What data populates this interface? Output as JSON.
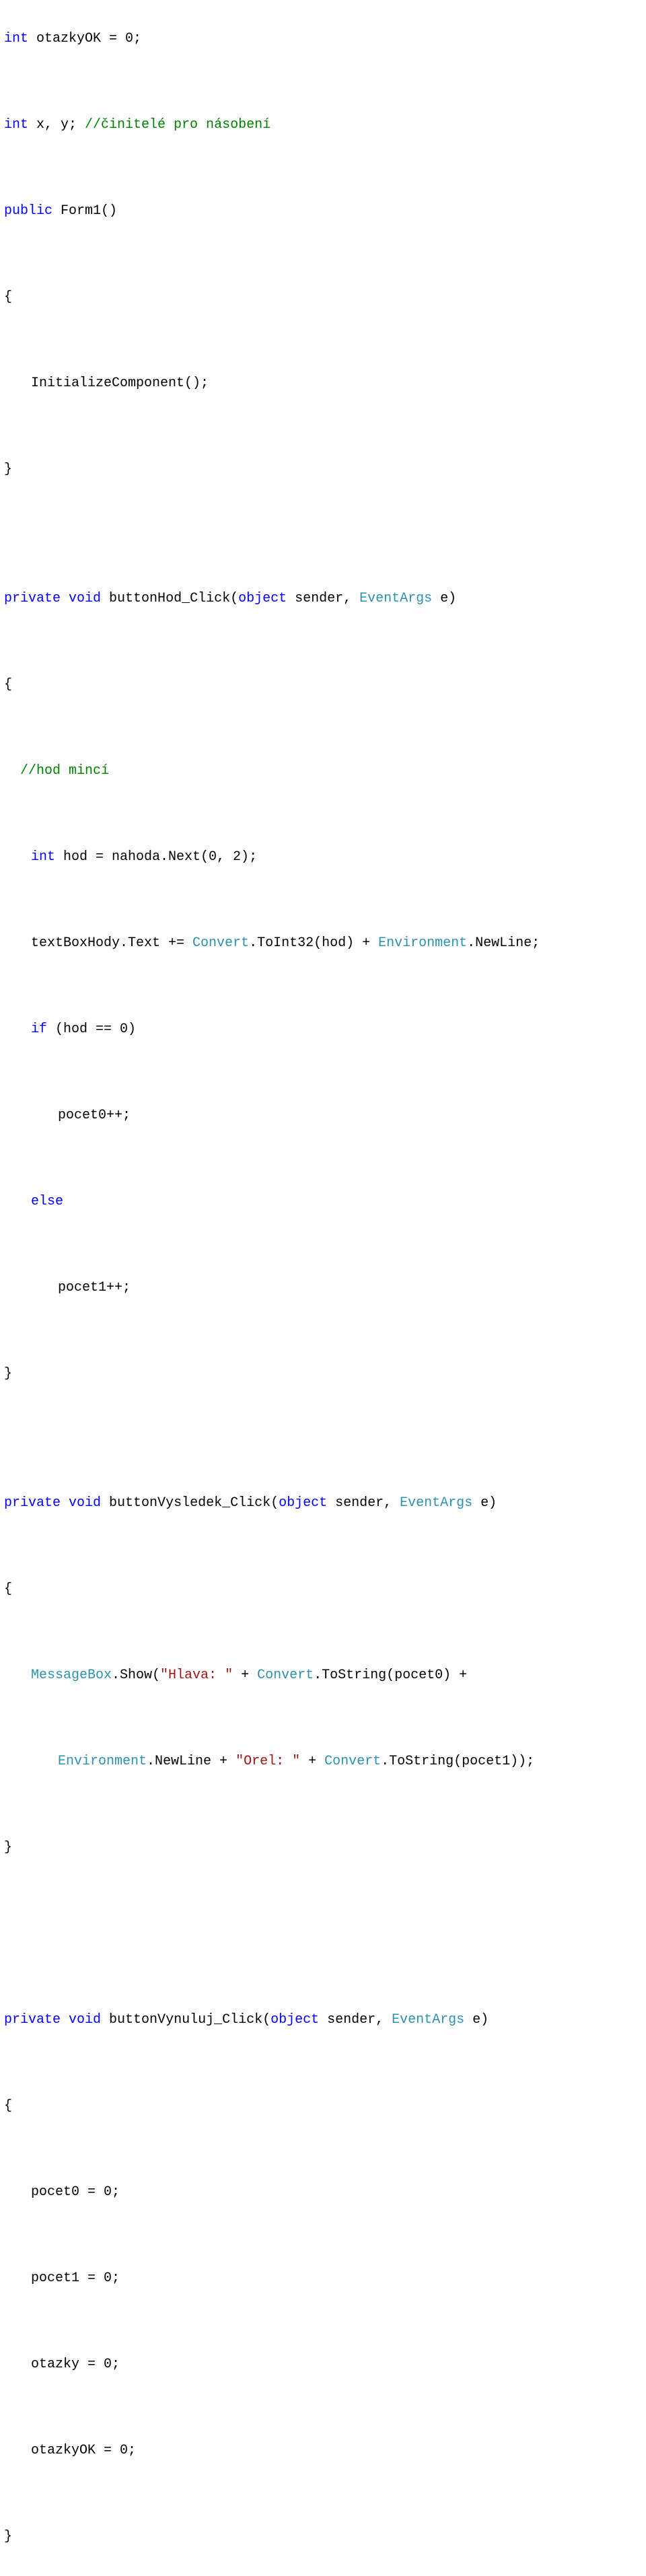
{
  "code": {
    "l01_kw_int": "int",
    "l01_rest": " otazkyOK = 0;",
    "l02_kw_int": "int",
    "l02_mid": " x, y; ",
    "l02_comment": "//činitelé pro násobení",
    "l03_kw_public": "public",
    "l03_rest": " Form1()",
    "l04": "{",
    "l05": "InitializeComponent();",
    "l06": "}",
    "l07_kw_private": "private",
    "l07_sp1": " ",
    "l07_kw_void": "void",
    "l07_mid": " buttonHod_Click(",
    "l07_kw_object": "object",
    "l07_mid2": " sender, ",
    "l07_cls": "EventArgs",
    "l07_end": " e)",
    "l08": "{",
    "l09_comment": "//hod mincí",
    "l10_kw_int": "int",
    "l10_rest": " hod = nahoda.Next(0, 2);",
    "l11_a": "textBoxHody.Text += ",
    "l11_cls1": "Convert",
    "l11_b": ".ToInt32(hod) + ",
    "l11_cls2": "Environment",
    "l11_c": ".NewLine;",
    "l12_kw_if": "if",
    "l12_rest": " (hod == 0)",
    "l13": "pocet0++;",
    "l14_kw_else": "else",
    "l15": "pocet1++;",
    "l16": "}",
    "l17_kw_private": "private",
    "l17_sp1": " ",
    "l17_kw_void": "void",
    "l17_mid": " buttonVysledek_Click(",
    "l17_kw_object": "object",
    "l17_mid2": " sender, ",
    "l17_cls": "EventArgs",
    "l17_end": " e)",
    "l18": "{",
    "l19_cls1": "MessageBox",
    "l19_a": ".Show(",
    "l19_str1": "\"Hlava: \"",
    "l19_b": " + ",
    "l19_cls2": "Convert",
    "l19_c": ".ToString(pocet0) +",
    "l20_cls1": "Environment",
    "l20_a": ".NewLine + ",
    "l20_str1": "\"Orel: \"",
    "l20_b": " + ",
    "l20_cls2": "Convert",
    "l20_c": ".ToString(pocet1));",
    "l21": "}",
    "l22_kw_private": "private",
    "l22_sp1": " ",
    "l22_kw_void": "void",
    "l22_mid": " buttonVynuluj_Click(",
    "l22_kw_object": "object",
    "l22_mid2": " sender, ",
    "l22_cls": "EventArgs",
    "l22_end": " e)",
    "l23": "{",
    "l24": "pocet0 = 0;",
    "l25": "pocet1 = 0;",
    "l26": "otazky = 0;",
    "l27": "otazkyOK = 0;",
    "l28": "}"
  }
}
